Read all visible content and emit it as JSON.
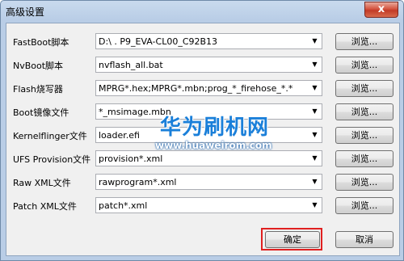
{
  "window": {
    "title": "高级设置",
    "close_glyph": "x"
  },
  "rows": [
    {
      "label": "FastBoot脚本",
      "value": "D:\\                  .                    P9_EVA-CL00_C92B13"
    },
    {
      "label": "NvBoot脚本",
      "value": "nvflash_all.bat"
    },
    {
      "label": "Flash烧写器",
      "value": "MPRG*.hex;MPRG*.mbn;prog_*_firehose_*.*"
    },
    {
      "label": "Boot镜像文件",
      "value": "*_msimage.mbn"
    },
    {
      "label": "Kernelflinger文件",
      "value": "loader.efi"
    },
    {
      "label": "UFS Provision文件",
      "value": "provision*.xml"
    },
    {
      "label": "Raw XML文件",
      "value": "rawprogram*.xml"
    },
    {
      "label": "Patch XML文件",
      "value": "patch*.xml"
    }
  ],
  "browse_label": "浏览...",
  "buttons": {
    "ok": "确定",
    "cancel": "取消"
  },
  "watermark": {
    "brand": "华为刷机网",
    "url": "www.huaweirom.com"
  },
  "colors": {
    "highlight": "#e02020",
    "watermark": "#1a7fd9"
  }
}
